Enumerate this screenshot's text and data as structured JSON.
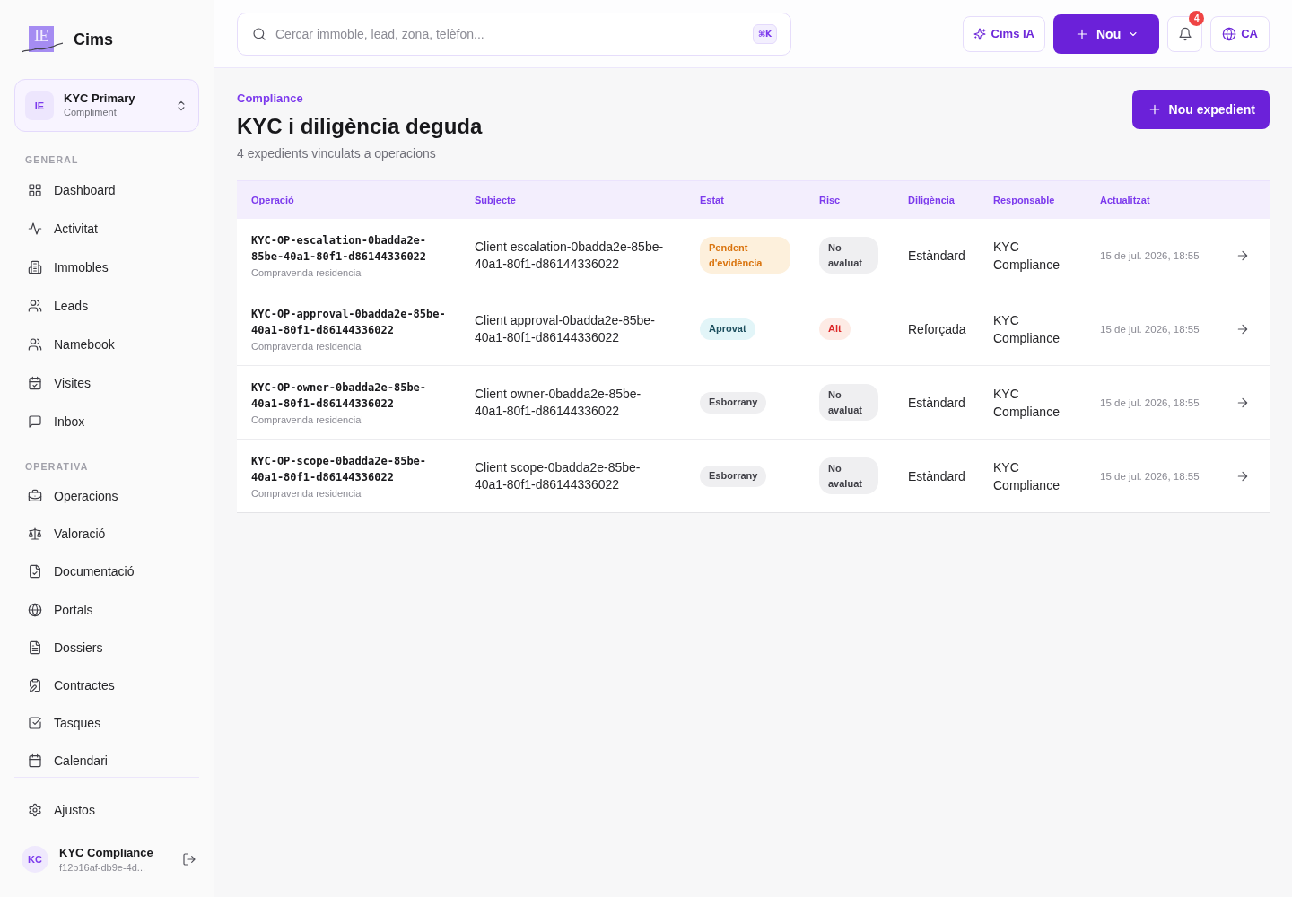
{
  "brand": {
    "mark": "IE",
    "name": "Cims"
  },
  "workspace": {
    "avatar": "IE",
    "name": "KYC Primary",
    "subtitle": "Compliment"
  },
  "sidebar": {
    "sections": [
      {
        "title": "GENERAL",
        "items": [
          {
            "label": "Dashboard"
          },
          {
            "label": "Activitat"
          },
          {
            "label": "Immobles"
          },
          {
            "label": "Leads"
          },
          {
            "label": "Namebook"
          },
          {
            "label": "Visites"
          },
          {
            "label": "Inbox"
          }
        ]
      },
      {
        "title": "OPERATIVA",
        "items": [
          {
            "label": "Operacions"
          },
          {
            "label": "Valoració"
          },
          {
            "label": "Documentació"
          },
          {
            "label": "Portals"
          },
          {
            "label": "Dossiers"
          },
          {
            "label": "Contractes"
          },
          {
            "label": "Tasques"
          },
          {
            "label": "Calendari"
          }
        ]
      }
    ],
    "footer_items": [
      {
        "label": "Ajustos"
      }
    ]
  },
  "user": {
    "initials": "KC",
    "name": "KYC Compliance",
    "id": "f12b16af-db9e-4d..."
  },
  "search": {
    "placeholder": "Cercar immoble, lead, zona, telèfon...",
    "shortcut": "⌘K"
  },
  "toolbar": {
    "ai_button": "Cims IA",
    "new_button": "Nou",
    "notifications": "4",
    "language": "CA"
  },
  "page": {
    "eyebrow": "Compliance",
    "title": "KYC i diligència deguda",
    "subtitle": "4 expedients vinculats a operacions",
    "action": "Nou expedient"
  },
  "table": {
    "columns": [
      "Operació",
      "Subjecte",
      "Estat",
      "Risc",
      "Diligència",
      "Responsable",
      "Actualitzat"
    ],
    "rows": [
      {
        "operation": "KYC-OP-escalation-0badda2e-85be-40a1-80f1-d86144336022",
        "operation_type": "Compravenda residencial",
        "subject": "Client escalation-0badda2e-85be-40a1-80f1-d86144336022",
        "status": {
          "label": "Pendent d'evidència",
          "kind": "warning"
        },
        "risk": {
          "label": "No avaluat",
          "kind": "neutral"
        },
        "diligence": "Estàndard",
        "owner": "KYC Compliance",
        "updated": "15 de jul. 2026, 18:55"
      },
      {
        "operation": "KYC-OP-approval-0badda2e-85be-40a1-80f1-d86144336022",
        "operation_type": "Compravenda residencial",
        "subject": "Client approval-0badda2e-85be-40a1-80f1-d86144336022",
        "status": {
          "label": "Aprovat",
          "kind": "success"
        },
        "risk": {
          "label": "Alt",
          "kind": "danger"
        },
        "diligence": "Reforçada",
        "owner": "KYC Compliance",
        "updated": "15 de jul. 2026, 18:55"
      },
      {
        "operation": "KYC-OP-owner-0badda2e-85be-40a1-80f1-d86144336022",
        "operation_type": "Compravenda residencial",
        "subject": "Client owner-0badda2e-85be-40a1-80f1-d86144336022",
        "status": {
          "label": "Esborrany",
          "kind": "neutral"
        },
        "risk": {
          "label": "No avaluat",
          "kind": "neutral"
        },
        "diligence": "Estàndard",
        "owner": "KYC Compliance",
        "updated": "15 de jul. 2026, 18:55"
      },
      {
        "operation": "KYC-OP-scope-0badda2e-85be-40a1-80f1-d86144336022",
        "operation_type": "Compravenda residencial",
        "subject": "Client scope-0badda2e-85be-40a1-80f1-d86144336022",
        "status": {
          "label": "Esborrany",
          "kind": "neutral"
        },
        "risk": {
          "label": "No avaluat",
          "kind": "neutral"
        },
        "diligence": "Estàndard",
        "owner": "KYC Compliance",
        "updated": "15 de jul. 2026, 18:55"
      }
    ]
  }
}
